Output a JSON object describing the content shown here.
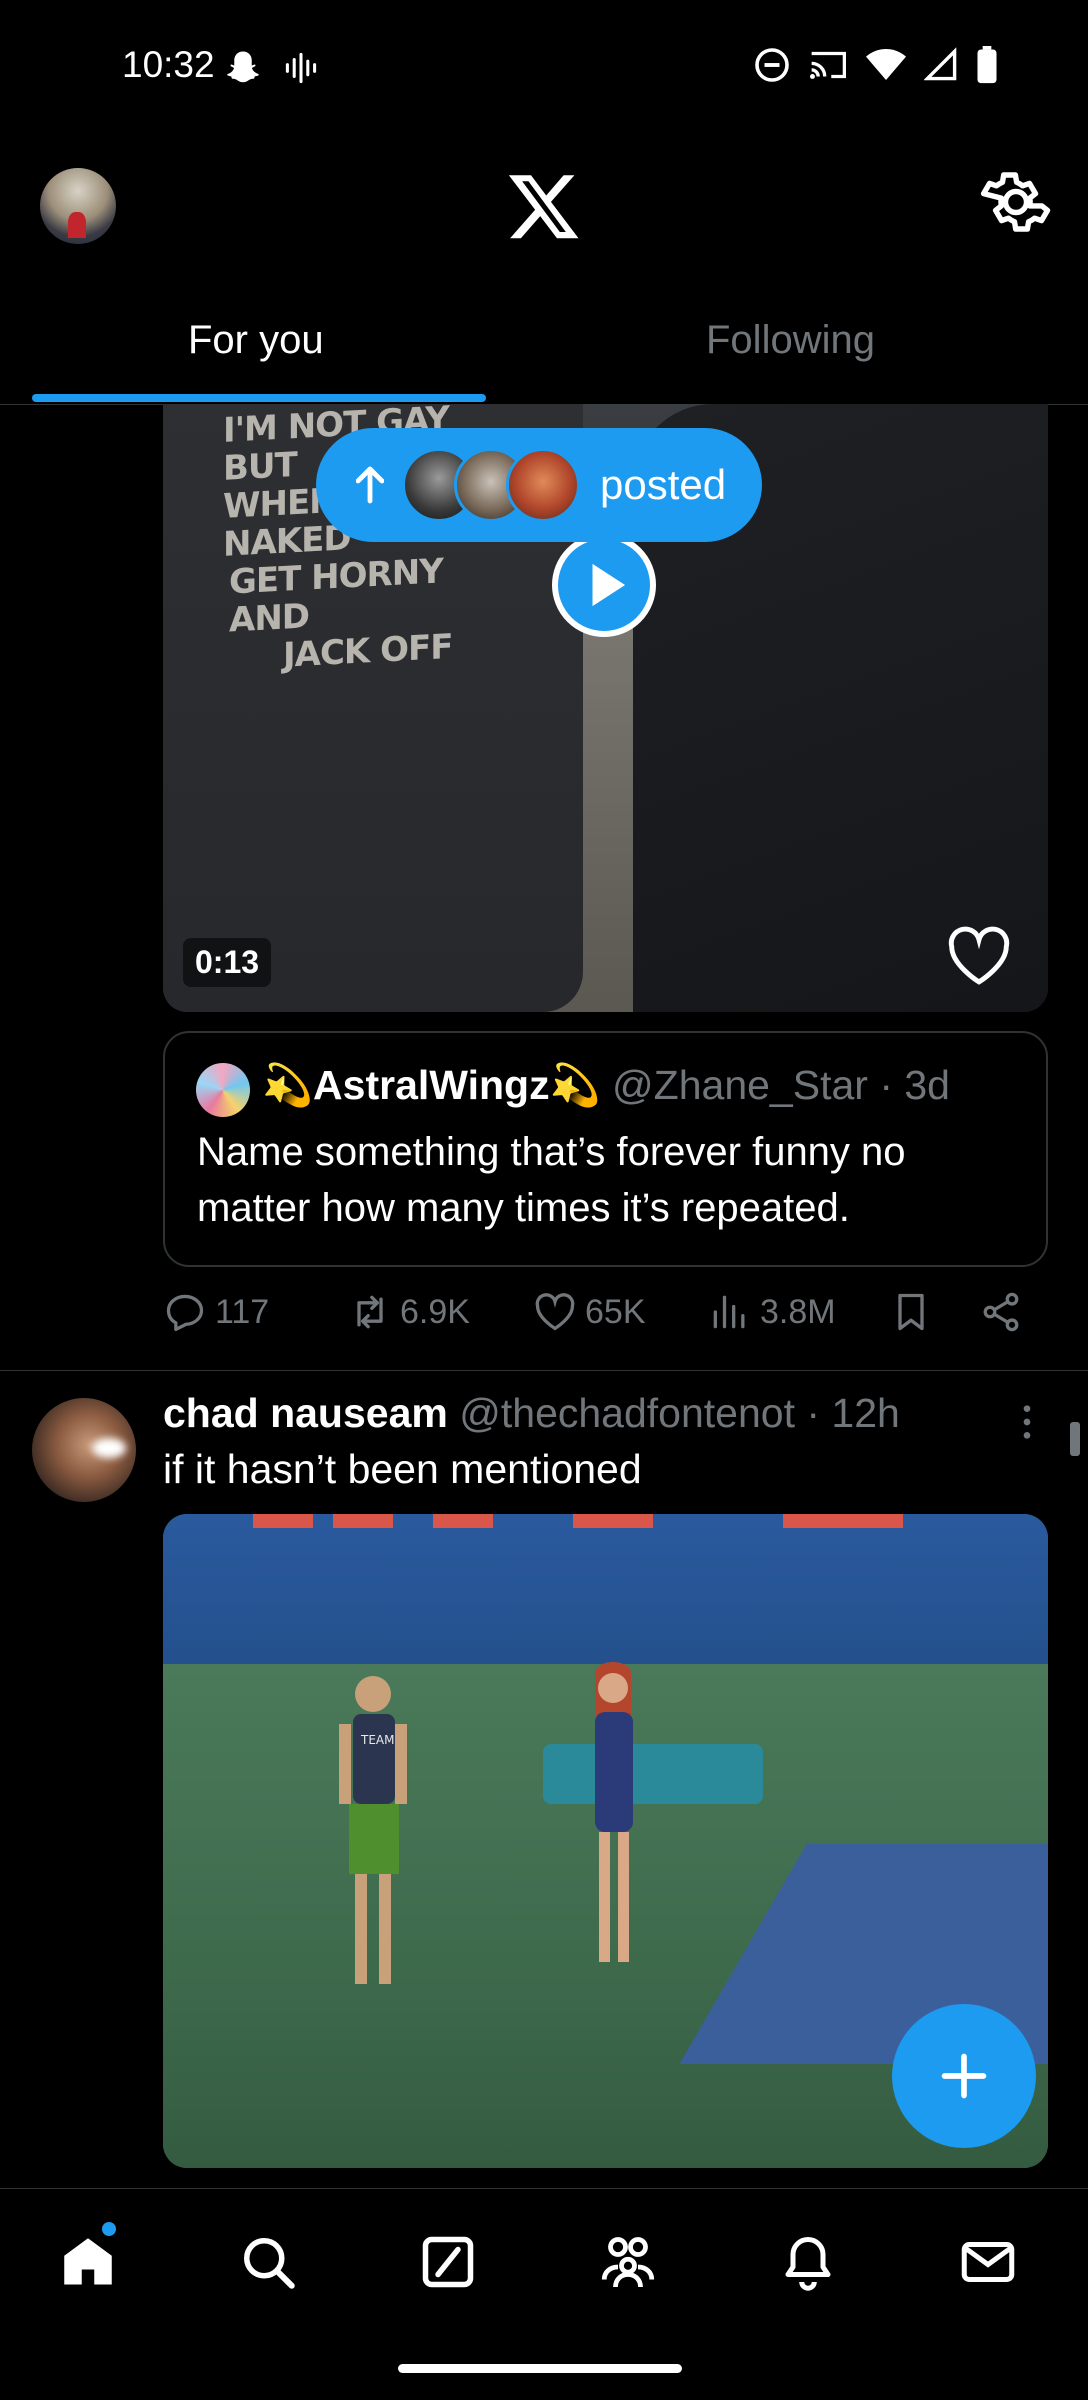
{
  "status_bar": {
    "time": "10:32"
  },
  "header": {
    "logo": "x-logo",
    "settings_icon": "gear-icon"
  },
  "tabs": [
    {
      "label": "For you",
      "active": true
    },
    {
      "label": "Following",
      "active": false
    }
  ],
  "new_posts_pill": {
    "label": "posted"
  },
  "post1": {
    "video": {
      "duration": "0:13",
      "shirt_text": [
        "I'M NOT GAY BUT",
        "WHEN I",
        "NAKED",
        "GET HORNY AND",
        "JACK OFF"
      ]
    },
    "quote": {
      "name": "💫AstralWingz💫",
      "handle": "@Zhane_Star",
      "time": "3d",
      "text": "Name something that’s forever funny no matter how many times it’s repeated."
    },
    "actions": {
      "replies": "117",
      "reposts": "6.9K",
      "likes": "65K",
      "views": "3.8M"
    }
  },
  "post2": {
    "name": "chad nauseam",
    "handle": "@thechadfontenot",
    "time": "12h",
    "text": "if it hasn’t been mentioned",
    "man_shirt_text": "TEAM"
  },
  "colors": {
    "accent": "#1d9bf0",
    "muted": "#71767b",
    "background": "#000000"
  }
}
